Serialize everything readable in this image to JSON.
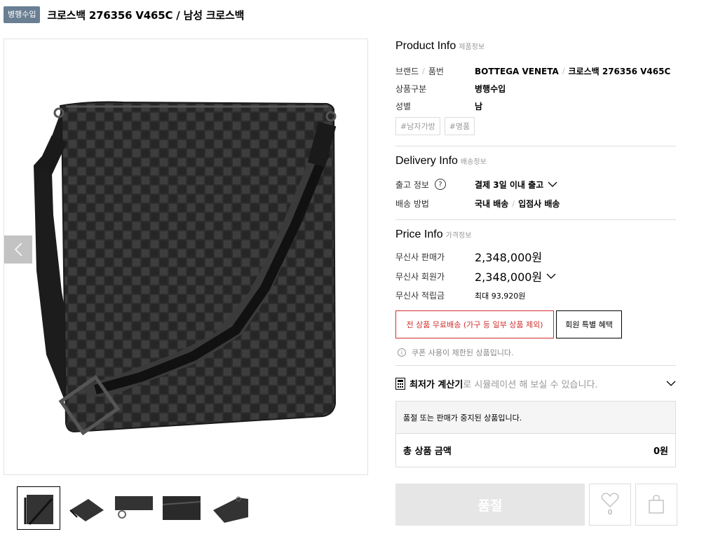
{
  "header": {
    "badge": "병행수입",
    "title": "크로스백 276356 V465C / 남성 크로스백"
  },
  "gallery": {
    "prev_icon": "chevron-left-icon",
    "next_icon": "chevron-right-icon",
    "thumbnails": [
      "thumb-1",
      "thumb-2",
      "thumb-3",
      "thumb-4",
      "thumb-5"
    ]
  },
  "product_info": {
    "title": "Product Info",
    "subtitle": "제품정보",
    "brand_label": "브랜드",
    "code_label": "품번",
    "brand": "BOTTEGA VENETA",
    "code": "크로스백 276356 V465C",
    "category_label": "상품구분",
    "category": "병행수입",
    "gender_label": "성별",
    "gender": "남",
    "tags": [
      "#남자가방",
      "#명품"
    ]
  },
  "delivery_info": {
    "title": "Delivery Info",
    "subtitle": "배송정보",
    "release_label": "출고 정보",
    "release_value": "결제 3일 이내 출고",
    "method_label": "배송 방법",
    "method_1": "국내 배송",
    "method_2": "입점사 배송"
  },
  "price_info": {
    "title": "Price Info",
    "subtitle": "가격정보",
    "sale_label": "무신사 판매가",
    "sale_price": "2,348,000원",
    "member_label": "무신사 회원가",
    "member_price": "2,348,000원",
    "points_label": "무신사 적립금",
    "points_value": "최대 93,920원",
    "free_shipping_btn": "전 상품 무료배송 (가구 등 일부 상품 제외)",
    "member_benefit_btn": "회원 특별 혜택",
    "coupon_notice": "쿠폰 사용이 제한된 상품입니다."
  },
  "calculator": {
    "bold": "최저가 계산기",
    "rest": "로 시뮬레이션 해 보실 수 있습니다."
  },
  "order": {
    "sold_message": "품절 또는 판매가 중지된 상품입니다.",
    "total_label": "총 상품 금액",
    "total_value": "0원",
    "soldout_button": "품절",
    "like_count": "0"
  },
  "colors": {
    "badge": "#6a7f93",
    "accent_red": "#d32f2f",
    "soldout_bg": "#e6e6e6"
  }
}
